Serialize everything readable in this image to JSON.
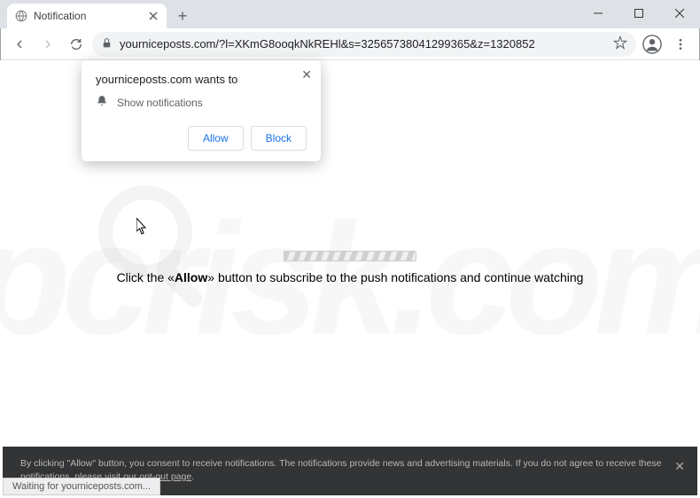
{
  "tab": {
    "title": "Notification"
  },
  "url": "yourniceposts.com/?l=XKmG8ooqkNkREHl&s=32565738041299365&z=1320852",
  "notif": {
    "title": "yourniceposts.com wants to",
    "permission": "Show notifications",
    "allow": "Allow",
    "block": "Block"
  },
  "page": {
    "instruction_prefix": "Click the «",
    "instruction_bold": "Allow",
    "instruction_suffix": "» button to subscribe to the push notifications and continue watching"
  },
  "consent": {
    "text": "By clicking \"Allow\" button, you consent to receive notifications. The notifications provide news and advertising materials. If you do not agree to receive these notifications, please visit our ",
    "link": "opt-out page"
  },
  "status": "Waiting for yourniceposts.com...",
  "watermark": "pcrisk.com"
}
